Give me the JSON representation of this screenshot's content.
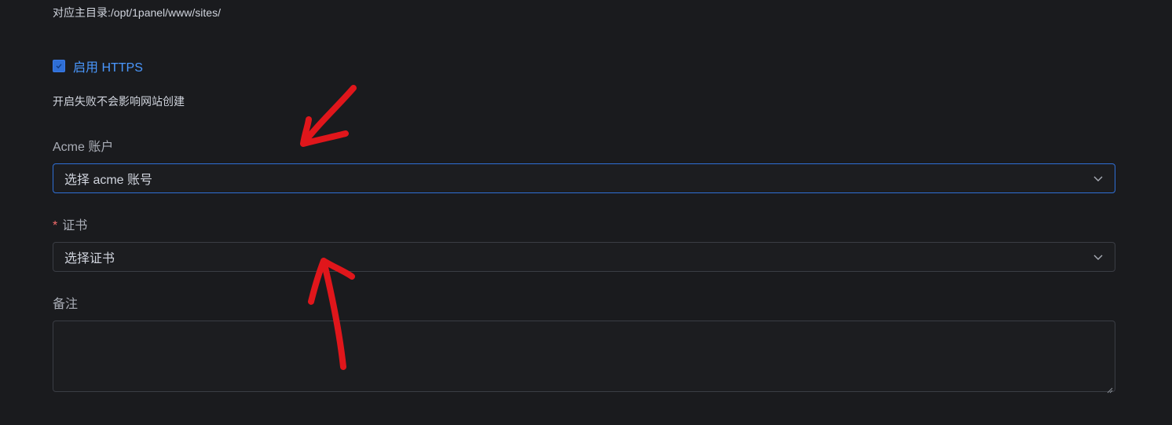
{
  "site_root_hint": "对应主目录:/opt/1panel/www/sites/",
  "https": {
    "label": "启用 HTTPS",
    "checked": true,
    "tip": "开启失败不会影响网站创建"
  },
  "acme": {
    "label": "Acme 账户",
    "placeholder": "选择 acme 账号"
  },
  "certificate": {
    "required_mark": "*",
    "label": "证书",
    "placeholder": "选择证书"
  },
  "remark": {
    "label": "备注",
    "value": ""
  },
  "colors": {
    "background": "#1a1b1e",
    "accent": "#2f6fd6",
    "link": "#4a98ff",
    "annotation": "#e0161b",
    "required": "#f56c6c"
  }
}
